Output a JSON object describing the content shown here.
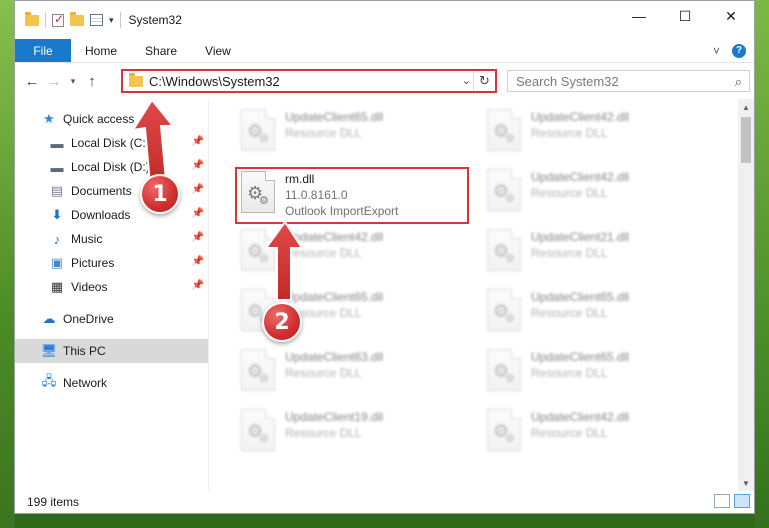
{
  "window": {
    "title": "System32",
    "controls": {
      "minimize": "—",
      "maximize": "☐",
      "close": "✕"
    }
  },
  "ribbon": {
    "file": "File",
    "tabs": [
      "Home",
      "Share",
      "View"
    ],
    "expand": "˅",
    "help": "?"
  },
  "address": {
    "path": "C:\\Windows\\System32",
    "search_placeholder": "Search System32"
  },
  "nav": {
    "items": [
      {
        "label": "Quick access",
        "icon": "star-icon"
      },
      {
        "label": "Local Disk (C:)",
        "icon": "drive-icon"
      },
      {
        "label": "Local Disk (D:)",
        "icon": "drive-icon"
      },
      {
        "label": "Documents",
        "icon": "documents-icon"
      },
      {
        "label": "Downloads",
        "icon": "download-icon"
      },
      {
        "label": "Music",
        "icon": "music-icon"
      },
      {
        "label": "Pictures",
        "icon": "pictures-icon"
      },
      {
        "label": "Videos",
        "icon": "videos-icon"
      },
      {
        "label": "OneDrive",
        "icon": "cloud-icon"
      },
      {
        "label": "This PC",
        "icon": "computer-icon"
      },
      {
        "label": "Network",
        "icon": "network-icon"
      }
    ]
  },
  "files": [
    {
      "name": "UpdateClient65.dll",
      "sub": "Resource DLL"
    },
    {
      "name": "UpdateClient42.dll",
      "sub": "Resource DLL"
    },
    {
      "name": "rm.dll",
      "sub": "11.0.8161.0",
      "sub2": "Outlook ImportExport"
    },
    {
      "name": "UpdateClient42.dll",
      "sub": "Resource DLL"
    },
    {
      "name": "UpdateClient42.dll",
      "sub": "Resource DLL"
    },
    {
      "name": "UpdateClient21.dll",
      "sub": "Resource DLL"
    },
    {
      "name": "UpdateClient65.dll",
      "sub": "Resource DLL"
    },
    {
      "name": "UpdateClient65.dll",
      "sub": "Resource DLL"
    },
    {
      "name": "UpdateClient63.dll",
      "sub": "Resource DLL"
    },
    {
      "name": "UpdateClient65.dll",
      "sub": "Resource DLL"
    },
    {
      "name": "UpdateClient19.dll",
      "sub": "Resource DLL"
    },
    {
      "name": "UpdateClient42.dll",
      "sub": "Resource DLL"
    }
  ],
  "status": {
    "items": "199 items"
  },
  "annotations": {
    "step1": "1",
    "step2": "2",
    "color": "#d9343a"
  }
}
